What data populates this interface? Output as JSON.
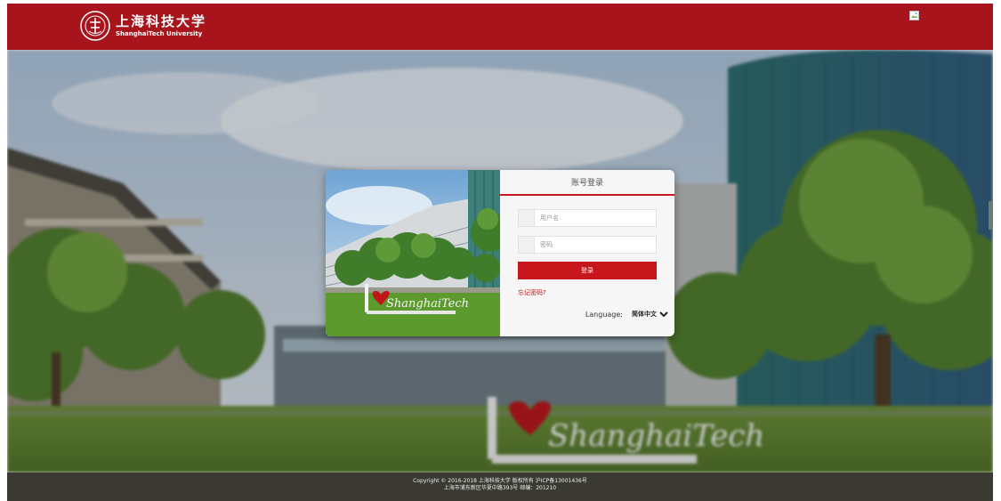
{
  "header": {
    "brand_cn": "上海科技大学",
    "brand_en": "ShanghaiTech University",
    "bg_color": "#a8141b"
  },
  "login": {
    "title": "账号登录",
    "username_placeholder": "用户名",
    "password_placeholder": "密码",
    "submit_label": "登录",
    "forgot_label": "忘记密码?",
    "language_label": "Language:",
    "language_selected": "简体中文",
    "accent_color": "#c8161d"
  },
  "footer": {
    "line1": "Copyright © 2016-2018 上海科技大学 版权所有   沪ICP备13001436号",
    "line2": "上海市浦东新区华夏中路393号 邮编：201210"
  }
}
